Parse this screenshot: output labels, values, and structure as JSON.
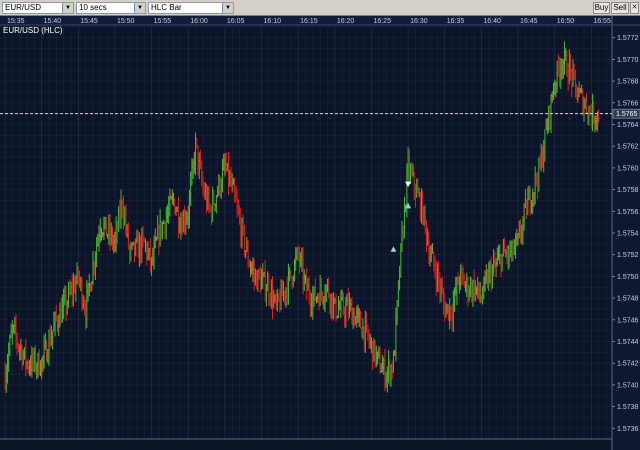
{
  "toolbar": {
    "symbol": "EUR/USD",
    "interval": "10 secs",
    "chart_style": "HLC Bar",
    "buy_label": "Buy",
    "sell_label": "Sell",
    "close_label": "✕"
  },
  "chart_title": "EUR/USD (HLC)",
  "colors": {
    "background": "#0c1428",
    "grid": "#1f2d4a",
    "up": "#3fbf2f",
    "down": "#e02020",
    "neutral": "#b88a2a",
    "marker": "#8fd0f0"
  },
  "chart_data": {
    "type": "bar",
    "style": "HLC",
    "x_ticks": [
      "15:35",
      "15:40",
      "15:45",
      "15:50",
      "15:55",
      "16:00",
      "16:05",
      "16:10",
      "16:15",
      "16:20",
      "16:25",
      "16:30",
      "16:35",
      "16:40",
      "16:45",
      "16:50",
      "16:55"
    ],
    "y_ticks": [
      "1.5772",
      "1.5770",
      "1.5768",
      "1.5766",
      "1.5764",
      "1.5762",
      "1.5760",
      "1.5758",
      "1.5756",
      "1.5754",
      "1.5752",
      "1.5750",
      "1.5748",
      "1.5746",
      "1.5744",
      "1.5742",
      "1.5740",
      "1.5738",
      "1.5736"
    ],
    "ylim": [
      1.5734,
      1.5774
    ],
    "current_price": 1.5765,
    "current_price_label": "1.5765",
    "price_path": [
      [
        "15:35",
        1.5741
      ],
      [
        "15:36",
        1.5745
      ],
      [
        "15:38",
        1.5742
      ],
      [
        "15:40",
        1.5742
      ],
      [
        "15:42",
        1.5746
      ],
      [
        "15:43",
        1.5747
      ],
      [
        "15:45",
        1.575
      ],
      [
        "15:46",
        1.5747
      ],
      [
        "15:47",
        1.5751
      ],
      [
        "15:48",
        1.5755
      ],
      [
        "15:50",
        1.5753
      ],
      [
        "15:51",
        1.5757
      ],
      [
        "15:52",
        1.5752
      ],
      [
        "15:54",
        1.5753
      ],
      [
        "15:55",
        1.5751
      ],
      [
        "15:56",
        1.5754
      ],
      [
        "15:58",
        1.5757
      ],
      [
        "15:59",
        1.5755
      ],
      [
        "16:00",
        1.5756
      ],
      [
        "16:01",
        1.5762
      ],
      [
        "16:02",
        1.5758
      ],
      [
        "16:03",
        1.5756
      ],
      [
        "16:04",
        1.5758
      ],
      [
        "16:05",
        1.576
      ],
      [
        "16:06",
        1.5758
      ],
      [
        "16:07",
        1.5755
      ],
      [
        "16:08",
        1.5752
      ],
      [
        "16:09",
        1.575
      ],
      [
        "16:11",
        1.5749
      ],
      [
        "16:12",
        1.5747
      ],
      [
        "16:14",
        1.575
      ],
      [
        "16:15",
        1.5752
      ],
      [
        "16:16",
        1.5749
      ],
      [
        "16:17",
        1.5748
      ],
      [
        "16:19",
        1.5749
      ],
      [
        "16:20",
        1.5747
      ],
      [
        "16:22",
        1.5747
      ],
      [
        "16:23",
        1.5746
      ],
      [
        "16:24",
        1.5745
      ],
      [
        "16:26",
        1.5742
      ],
      [
        "16:27",
        1.5741
      ],
      [
        "16:28",
        1.5742
      ],
      [
        "16:29",
        1.5752
      ],
      [
        "16:30",
        1.576
      ],
      [
        "16:31",
        1.5758
      ],
      [
        "16:32",
        1.5756
      ],
      [
        "16:33",
        1.5752
      ],
      [
        "16:34",
        1.575
      ],
      [
        "16:35",
        1.5747
      ],
      [
        "16:36",
        1.5747
      ],
      [
        "16:37",
        1.575
      ],
      [
        "16:38",
        1.5749
      ],
      [
        "16:39",
        1.5749
      ],
      [
        "16:40",
        1.5748
      ],
      [
        "16:41",
        1.575
      ],
      [
        "16:42",
        1.5751
      ],
      [
        "16:43",
        1.5752
      ],
      [
        "16:44",
        1.5752
      ],
      [
        "16:45",
        1.5753
      ],
      [
        "16:46",
        1.5756
      ],
      [
        "16:47",
        1.5758
      ],
      [
        "16:48",
        1.576
      ],
      [
        "16:49",
        1.5764
      ],
      [
        "16:50",
        1.5768
      ],
      [
        "16:51",
        1.577
      ],
      [
        "16:52",
        1.5769
      ],
      [
        "16:53",
        1.5767
      ],
      [
        "16:54",
        1.5766
      ],
      [
        "16:55",
        1.5765
      ],
      [
        "16:56",
        1.5765
      ]
    ],
    "markers": [
      {
        "x": "16:28",
        "y": 1.57525,
        "kind": "up-triangle"
      },
      {
        "x": "16:30",
        "y": 1.57585,
        "kind": "down-triangle"
      },
      {
        "x": "16:30",
        "y": 1.57565,
        "kind": "up-triangle"
      }
    ],
    "grid": true
  }
}
